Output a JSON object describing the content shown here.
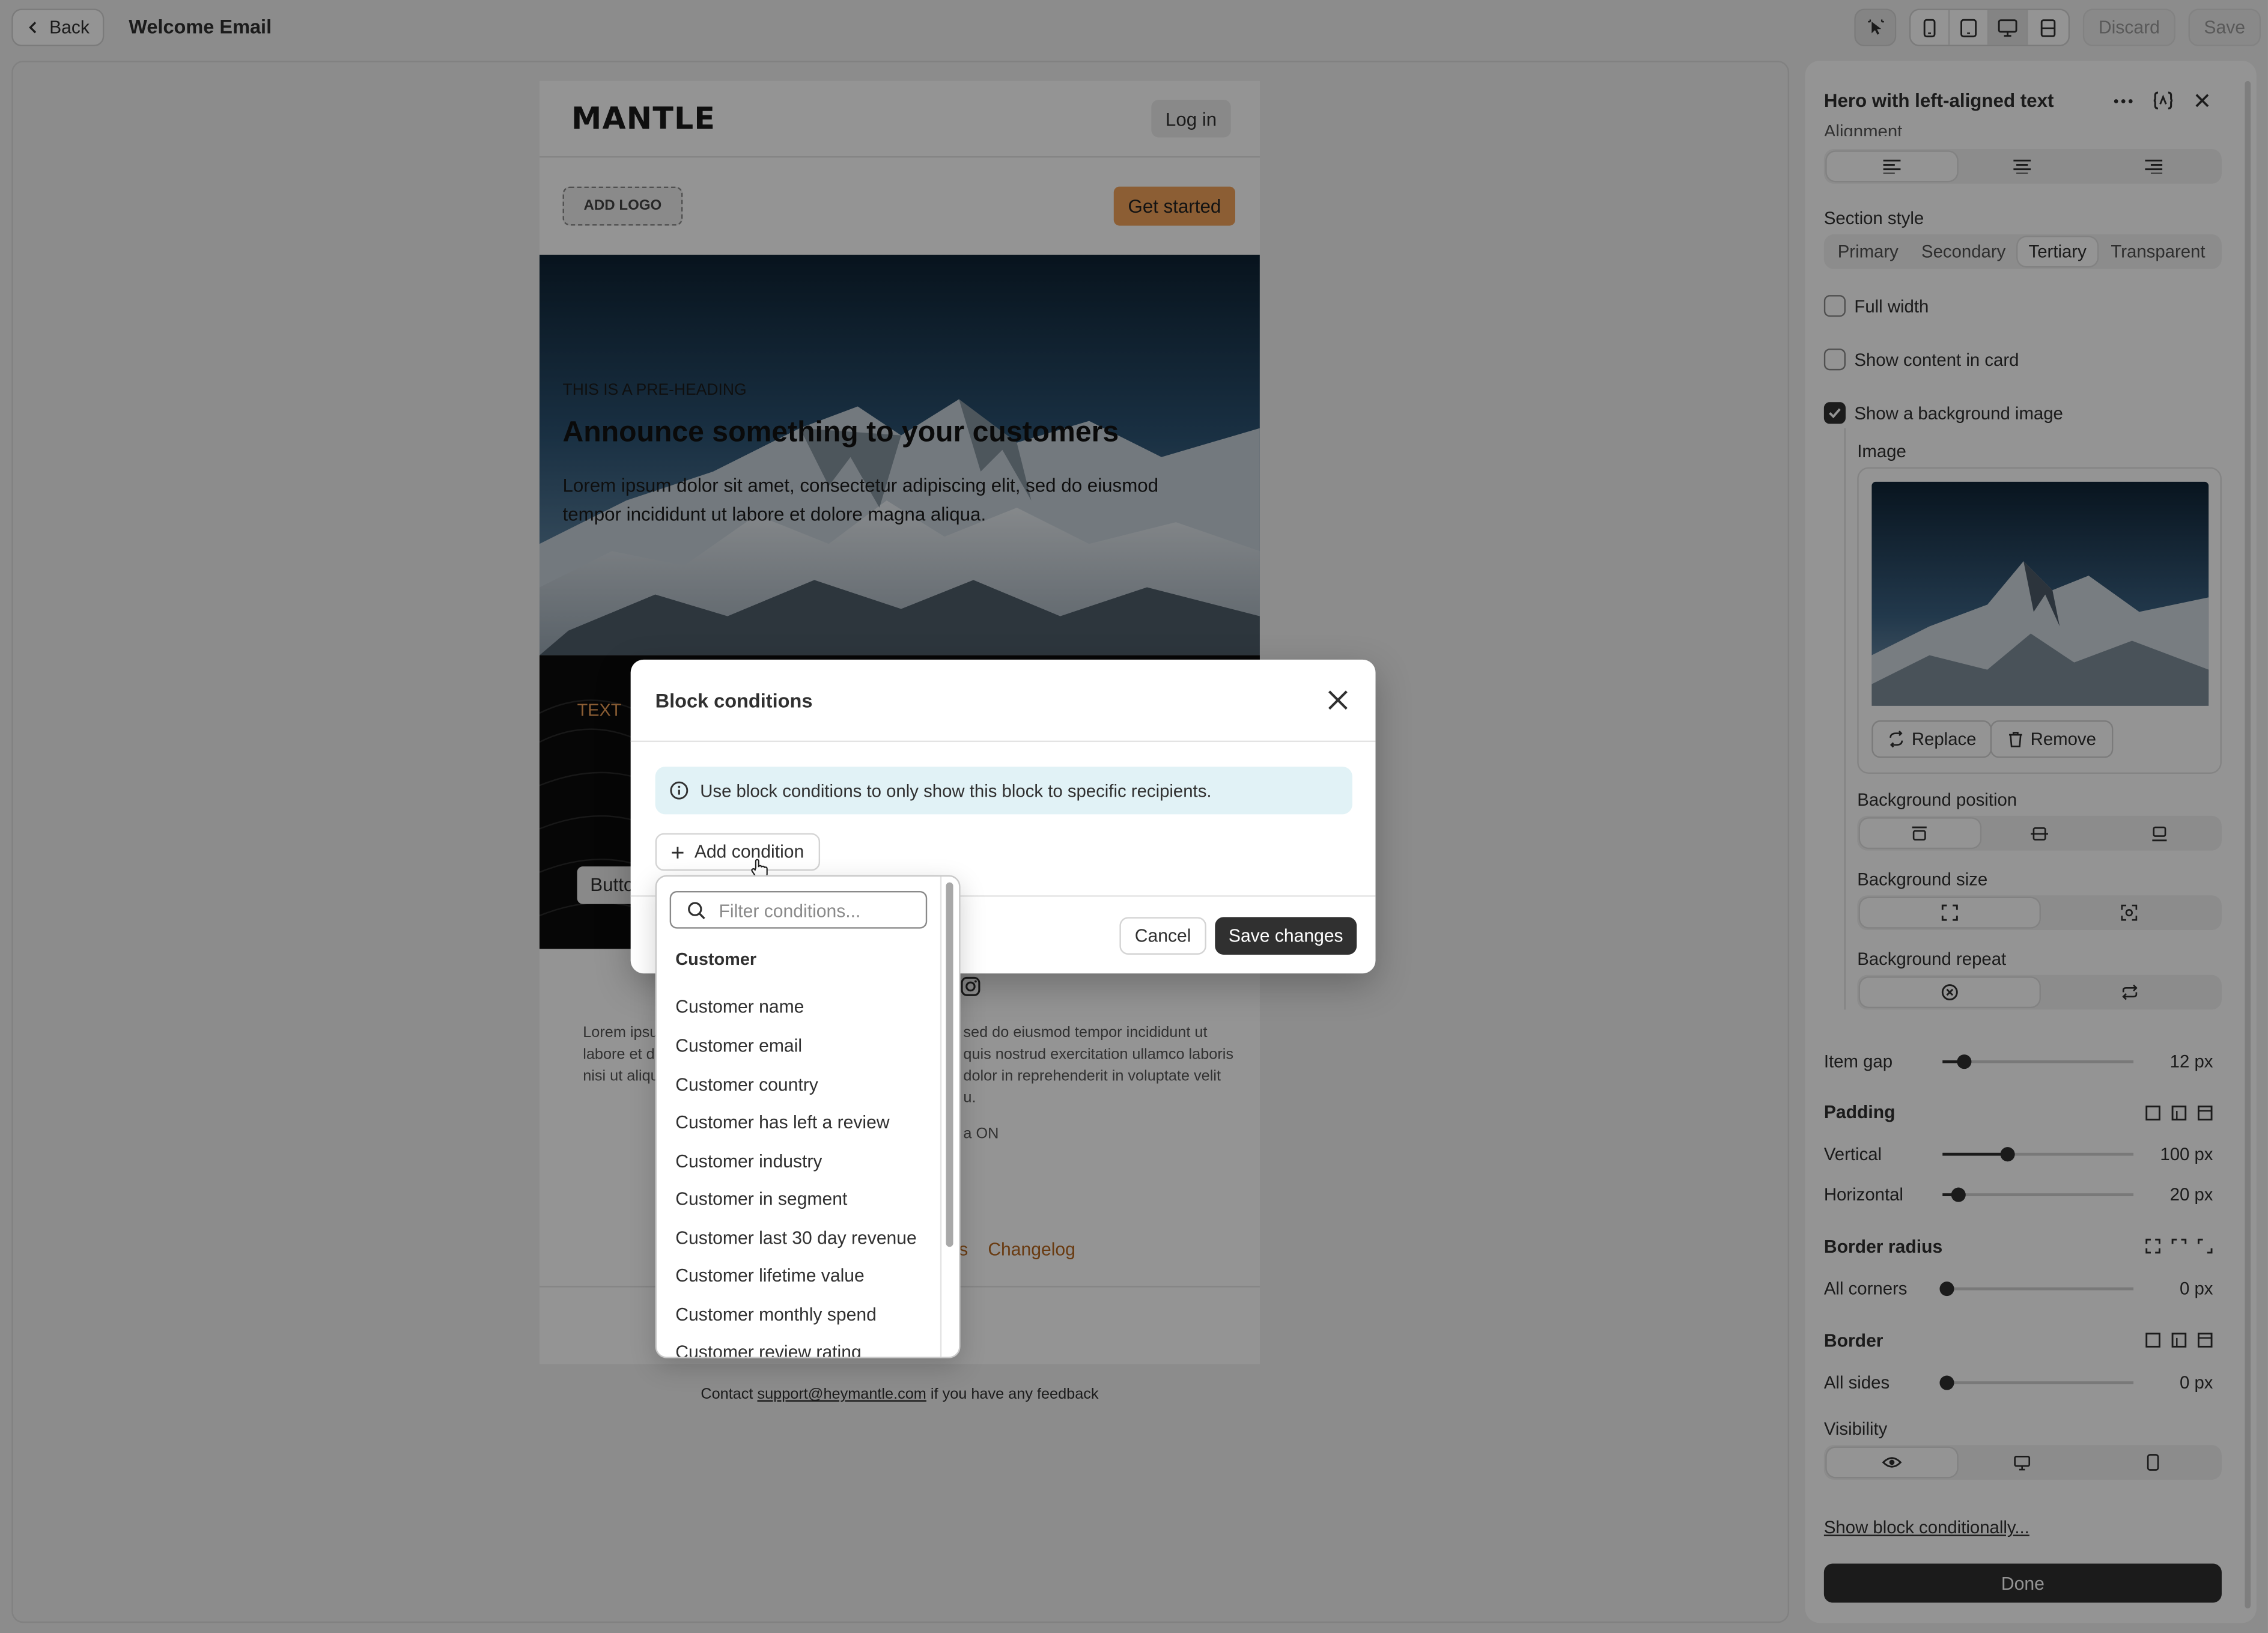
{
  "topbar": {
    "back_label": "Back",
    "title": "Welcome Email",
    "discard_label": "Discard",
    "save_label": "Save"
  },
  "email": {
    "logo_text": "MANTLE",
    "login_label": "Log in",
    "add_logo_label": "ADD LOGO",
    "get_started_label": "Get started",
    "pre_heading": "THIS IS A PRE-HEADING",
    "headline": "Announce something to your customers",
    "body_line1": "Lorem ipsum dolor sit amet, consectetur adipiscing elit, sed do eiusmod",
    "body_line2": "tempor incididunt ut labore et dolore magna aliqua.",
    "text_label": "TEXT",
    "button_label": "Butto",
    "footer_left_1": "Lorem ipsu",
    "footer_left_2": "labore et dol",
    "footer_left_3": "nisi ut aliqui",
    "footer_right_1": "sed do eiusmod tempor incididunt ut",
    "footer_right_2": "quis nostrud exercitation ullamco laboris",
    "footer_right_3": "dolor in reprehenderit in voluptate velit",
    "footer_right_4": "u.",
    "footer_right_5": "a ON",
    "link_partial": "s",
    "link_changelog": "Changelog",
    "contact_prefix": "Contact ",
    "contact_email": "support@heymantle.com",
    "contact_suffix": " if you have any feedback"
  },
  "modal": {
    "title": "Block conditions",
    "info_text": "Use block conditions to only show this block to specific recipients.",
    "add_condition_label": "Add condition",
    "cancel_label": "Cancel",
    "save_label": "Save changes"
  },
  "dropdown": {
    "placeholder": "Filter conditions...",
    "group": "Customer",
    "items": [
      "Customer name",
      "Customer email",
      "Customer country",
      "Customer has left a review",
      "Customer industry",
      "Customer in segment",
      "Customer last 30 day revenue",
      "Customer lifetime value",
      "Customer monthly spend",
      "Customer review rating"
    ]
  },
  "panel": {
    "title": "Hero with left-aligned text",
    "alignment_label": "Alignment",
    "section_style_label": "Section style",
    "section_styles": [
      "Primary",
      "Secondary",
      "Tertiary",
      "Transparent"
    ],
    "section_style_selected": "Tertiary",
    "full_width_label": "Full width",
    "show_card_label": "Show content in card",
    "show_bg_label": "Show a background image",
    "image_label": "Image",
    "replace_label": "Replace",
    "remove_label": "Remove",
    "bg_position_label": "Background position",
    "bg_size_label": "Background size",
    "bg_repeat_label": "Background repeat",
    "item_gap_label": "Item gap",
    "item_gap_value": "12 px",
    "padding_label": "Padding",
    "vertical_label": "Vertical",
    "vertical_value": "100 px",
    "horizontal_label": "Horizontal",
    "horizontal_value": "20 px",
    "border_radius_label": "Border radius",
    "all_corners_label": "All corners",
    "all_corners_value": "0 px",
    "border_label": "Border",
    "all_sides_label": "All sides",
    "all_sides_value": "0 px",
    "visibility_label": "Visibility",
    "show_conditionally_label": "Show block conditionally...",
    "done_label": "Done"
  },
  "colors": {
    "accent_orange": "#f2a35b",
    "dark_button": "#303030",
    "info_bg": "#e1f2f6"
  }
}
